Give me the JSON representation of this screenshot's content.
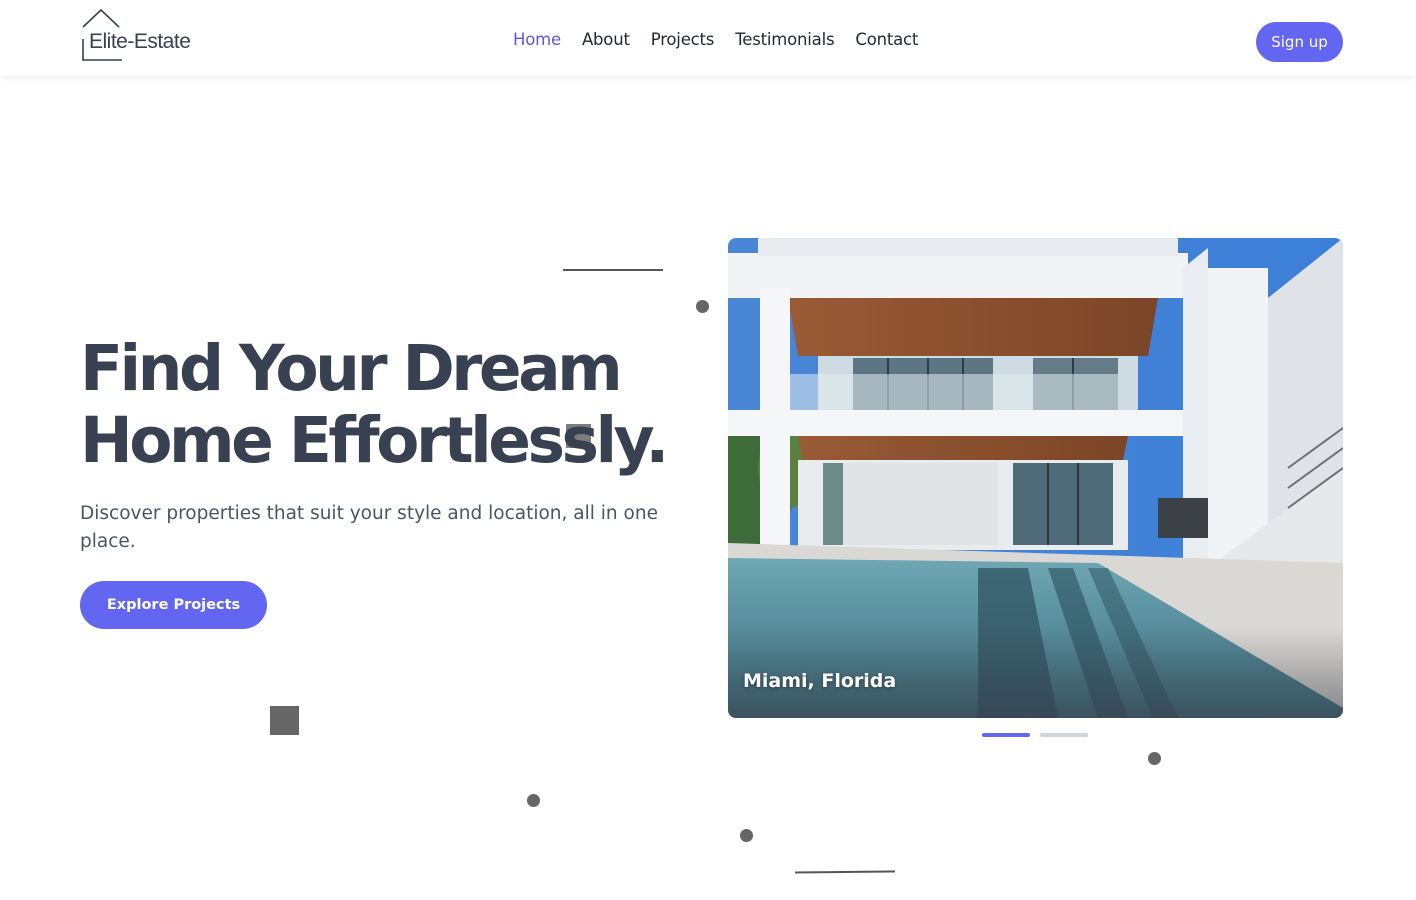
{
  "header": {
    "brand": "Elite-Estate",
    "nav": [
      {
        "label": "Home",
        "active": true
      },
      {
        "label": "About",
        "active": false
      },
      {
        "label": "Projects",
        "active": false
      },
      {
        "label": "Testimonials",
        "active": false
      },
      {
        "label": "Contact",
        "active": false
      }
    ],
    "signup_label": "Sign up"
  },
  "hero": {
    "title_line1": "Find Your Dream",
    "title_line2": "Home Effortlessly.",
    "subtitle": "Discover properties that suit your style and location, all in one place.",
    "cta_label": "Explore Projects"
  },
  "carousel": {
    "location": "Miami, Florida",
    "slide_count": 2,
    "active_slide": 1
  },
  "colors": {
    "accent": "#6366f1",
    "heading": "#374151",
    "text": "#4b5563",
    "decor": "#666666"
  }
}
